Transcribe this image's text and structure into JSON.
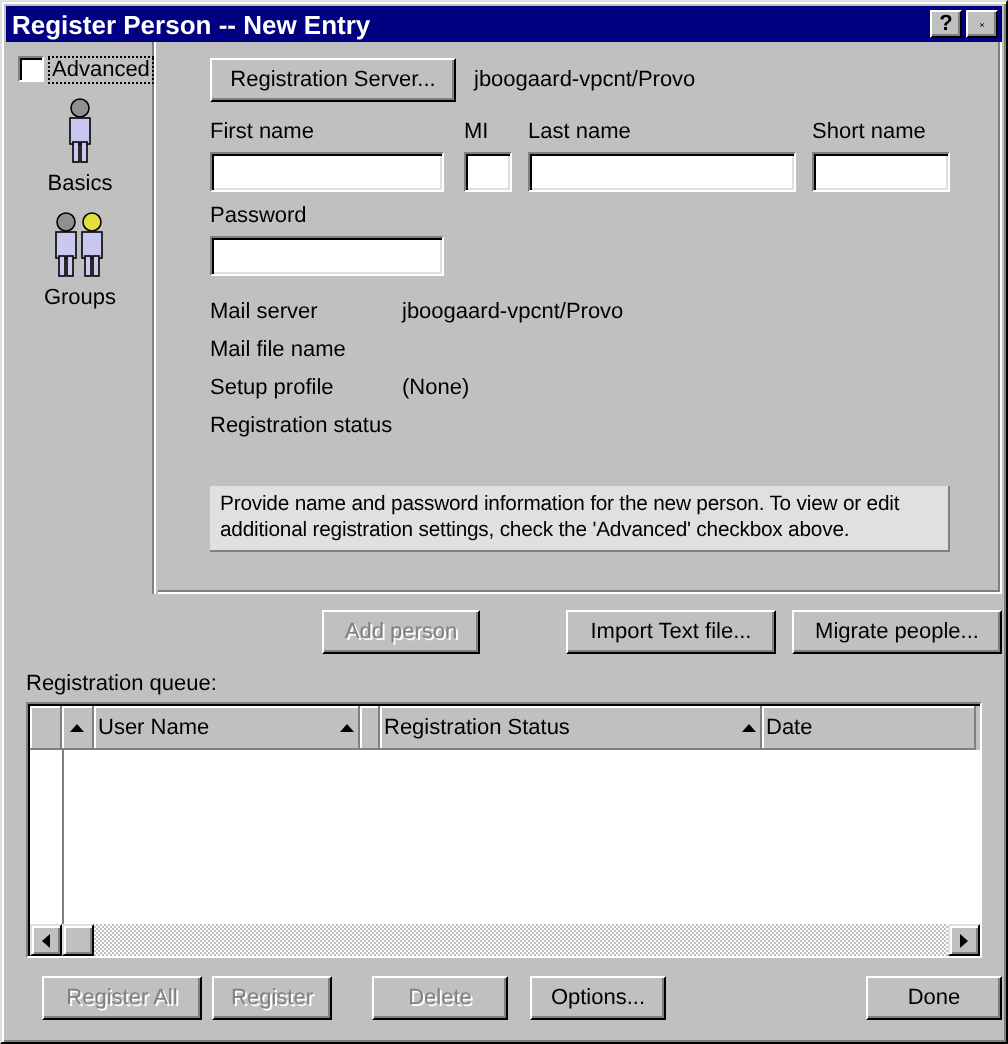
{
  "window": {
    "title": "Register Person -- New Entry",
    "help_button": "?"
  },
  "advanced": {
    "label": "Advanced",
    "checked": false
  },
  "sidebar": {
    "items": [
      {
        "label": "Basics",
        "kind": "person"
      },
      {
        "label": "Groups",
        "kind": "group"
      }
    ]
  },
  "registration_server": {
    "button": "Registration Server...",
    "value": "jboogaard-vpcnt/Provo"
  },
  "name_fields": [
    {
      "label": "First name"
    },
    {
      "label": "MI"
    },
    {
      "label": "Last name"
    },
    {
      "label": "Short name"
    }
  ],
  "password": {
    "label": "Password"
  },
  "info": [
    {
      "label": "Mail server",
      "value": "jboogaard-vpcnt/Provo"
    },
    {
      "label": "Mail file name"
    },
    {
      "label": "Setup profile",
      "value": "(None)"
    },
    {
      "label": "Registration status"
    }
  ],
  "hint": "Provide name and password information for the new person.  To view or edit additional registration settings, check the 'Advanced' checkbox above.",
  "actions": [
    {
      "label": "Add person",
      "disabled": true
    },
    {
      "label": "Import Text file...",
      "disabled": false
    },
    {
      "label": "Migrate people...",
      "disabled": false
    }
  ],
  "queue": {
    "label": "Registration queue:",
    "columns": [
      "User Name",
      "Registration Status",
      "Date"
    ]
  },
  "footer_buttons": [
    {
      "label": "Register All",
      "disabled": true
    },
    {
      "label": "Register",
      "disabled": true
    },
    {
      "label": "Delete",
      "disabled": true
    },
    {
      "label": "Options...",
      "disabled": false
    },
    {
      "label": "Done",
      "disabled": false
    }
  ]
}
